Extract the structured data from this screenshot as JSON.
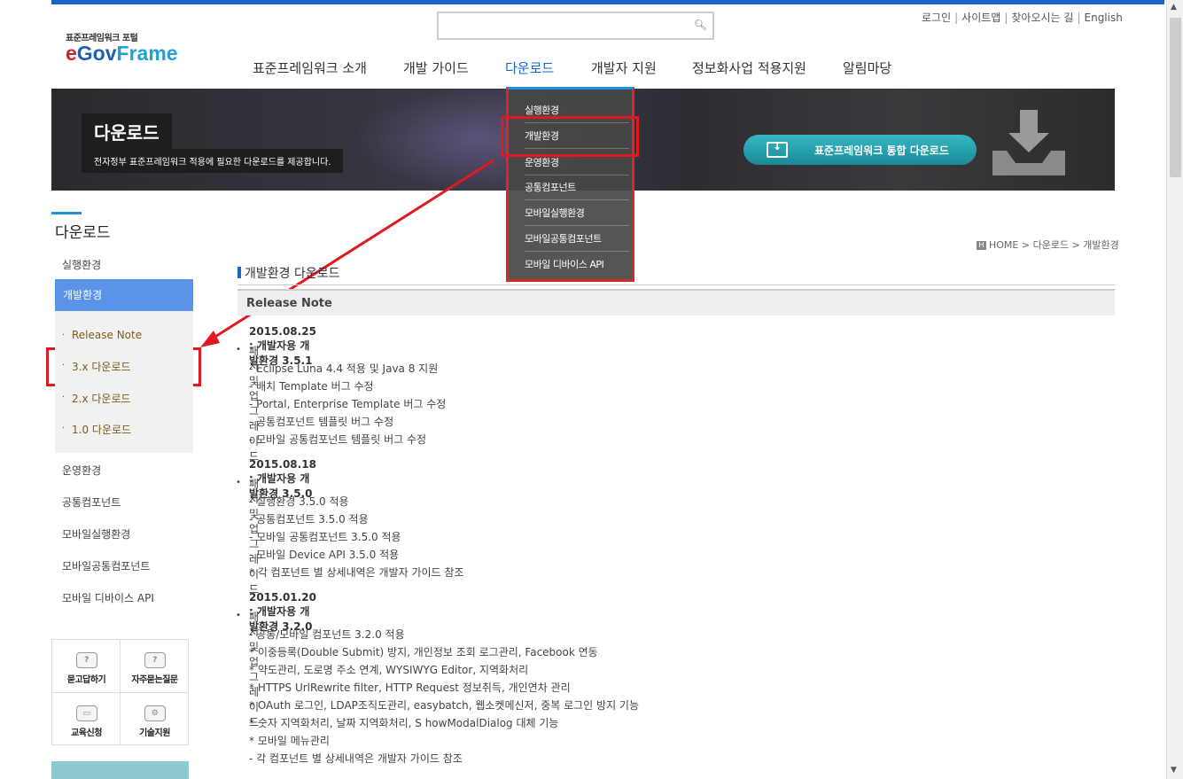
{
  "logo": {
    "small": "표준프레임워크 포털",
    "e": "e",
    "gov": "Gov",
    "frame": "Frame"
  },
  "search": {
    "value": "",
    "placeholder": ""
  },
  "util_links": [
    "로그인",
    "사이트맵",
    "찾아오시는 길",
    "English"
  ],
  "gnb": [
    "표준프레임워크 소개",
    "개발 가이드",
    "다운로드",
    "개발자 지원",
    "정보화사업 적용지원",
    "알림마당"
  ],
  "banner": {
    "title": "다운로드",
    "subtitle": "전자정부 표준프레임워크 적용에 필요한 다운로드를 제공합니다.",
    "download_button": "표준프레임워크  통합 다운로드"
  },
  "submenu": [
    "실행환경",
    "개발환경",
    "운영환경",
    "공통컴포넌트",
    "모바일실행환경",
    "모바일공통컴포넌트",
    "모바일 디바이스 API"
  ],
  "lnb": {
    "title": "다운로드",
    "items_before": [
      "실행환경"
    ],
    "active": "개발환경",
    "sub_items": [
      "Release Note",
      "3.x 다운로드",
      "2.x 다운로드",
      "1.0 다운로드"
    ],
    "items_after": [
      "운영환경",
      "공통컴포넌트",
      "모바일실행환경",
      "모바일공통컴포넌트",
      "모바일 디바이스 API"
    ]
  },
  "quick": [
    "묻고답하기",
    "자주묻는질문",
    "교육신청",
    "기술지원"
  ],
  "breadcrumb": {
    "home": "HOME",
    "level1": "다운로드",
    "level2": "개발환경"
  },
  "content": {
    "title": "개발환경 다운로드",
    "section": "Release Note",
    "releases": [
      {
        "version": "2015.08.25 : 개발자용 개발환경 3.5.1",
        "category": "패치 및 업그레이드",
        "lines": [
          "- Eclipse Luna 4.4 적용 및 Java 8 지원",
          "- 배치 Template 버그 수정",
          "- Portal, Enterprise Template 버그 수정",
          "- 공통컴포넌트 템플릿 버그 수정",
          "- 모바일 공통컴포넌트 템플릿 버그 수정"
        ]
      },
      {
        "version": "2015.08.18 : 개발자용 개발환경 3.5.0",
        "category": "패치 및 업그레이드",
        "lines": [
          "- 실행환경 3.5.0 적용",
          "- 공통컴포넌트 3.5.0 적용",
          "- 모바일 공통컴포넌트 3.5.0 적용",
          "- 모바일 Device API 3.5.0 적용",
          "* 각 컴포넌트 별 상세내역은 개발자 가이드 참조"
        ]
      },
      {
        "version": "2015.01.20 : 개발자용 개발환경 3.2.0",
        "category": "패치 및 업그레이드",
        "lines": [
          "- 공통/모바일 컴포넌트 3.2.0 적용",
          "* 이중등록(Double Submit) 방지, 개인정보 조회 로그관리, Facebook 연동",
          "* 약도관리, 도로명 주소 연계, WYSIWYG Editor, 지역화처리",
          "* HTTPS UrlRewrite filter, HTTP Request 정보취득, 개인연차 관리",
          "* OAuth 로그인, LDAP조직도관리, easybatch, 웹소켓메신저, 중복 로그인 방지 기능",
          "* 숫자 지역화처리, 날짜 지역화처리, S howModalDialog 대체 기능",
          "* 모바일 메뉴관리",
          "- 각 컴포넌트 별 상세내역은 개발자 가이드 참조"
        ]
      }
    ]
  },
  "colors": {
    "accent": "#1667c9",
    "highlight": "#e0191f",
    "lnb_active": "#5b93e8",
    "teal_button": "#1a8a98"
  }
}
